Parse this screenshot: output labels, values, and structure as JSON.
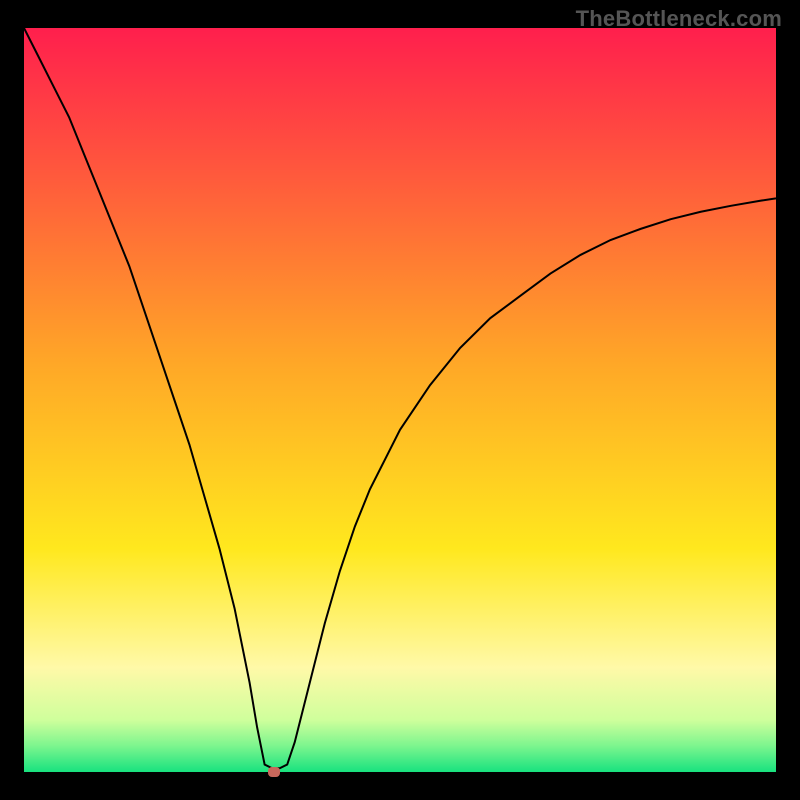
{
  "watermark": "TheBottleneck.com",
  "chart_data": {
    "type": "line",
    "title": "",
    "xlabel": "",
    "ylabel": "",
    "legend": false,
    "grid": false,
    "x_range": [
      0,
      100
    ],
    "y_range": [
      0,
      100
    ],
    "background": {
      "kind": "vertical-gradient",
      "stops": [
        {
          "pos": 0.0,
          "color": "#ff1f4d"
        },
        {
          "pos": 0.2,
          "color": "#ff5a3c"
        },
        {
          "pos": 0.45,
          "color": "#ffa727"
        },
        {
          "pos": 0.7,
          "color": "#ffe81e"
        },
        {
          "pos": 0.86,
          "color": "#fff9a8"
        },
        {
          "pos": 0.93,
          "color": "#cfff9c"
        },
        {
          "pos": 0.965,
          "color": "#7cf58e"
        },
        {
          "pos": 1.0,
          "color": "#18e27f"
        }
      ]
    },
    "series": [
      {
        "name": "bottleneck-curve",
        "color": "#000000",
        "stroke_width": 2,
        "x": [
          0,
          2,
          4,
          6,
          8,
          10,
          12,
          14,
          16,
          18,
          20,
          22,
          24,
          26,
          28,
          30,
          31,
          32,
          33,
          34,
          35,
          36,
          38,
          40,
          42,
          44,
          46,
          48,
          50,
          54,
          58,
          62,
          66,
          70,
          74,
          78,
          82,
          86,
          90,
          94,
          98,
          100
        ],
        "y": [
          100,
          96,
          92,
          88,
          83,
          78,
          73,
          68,
          62,
          56,
          50,
          44,
          37,
          30,
          22,
          12,
          6,
          1,
          0.5,
          0.5,
          1,
          4,
          12,
          20,
          27,
          33,
          38,
          42,
          46,
          52,
          57,
          61,
          64,
          67,
          69.5,
          71.5,
          73,
          74.3,
          75.3,
          76.1,
          76.8,
          77.1
        ]
      }
    ],
    "marker": {
      "x": 33.3,
      "y": 0.0,
      "color": "#c8675b"
    }
  }
}
